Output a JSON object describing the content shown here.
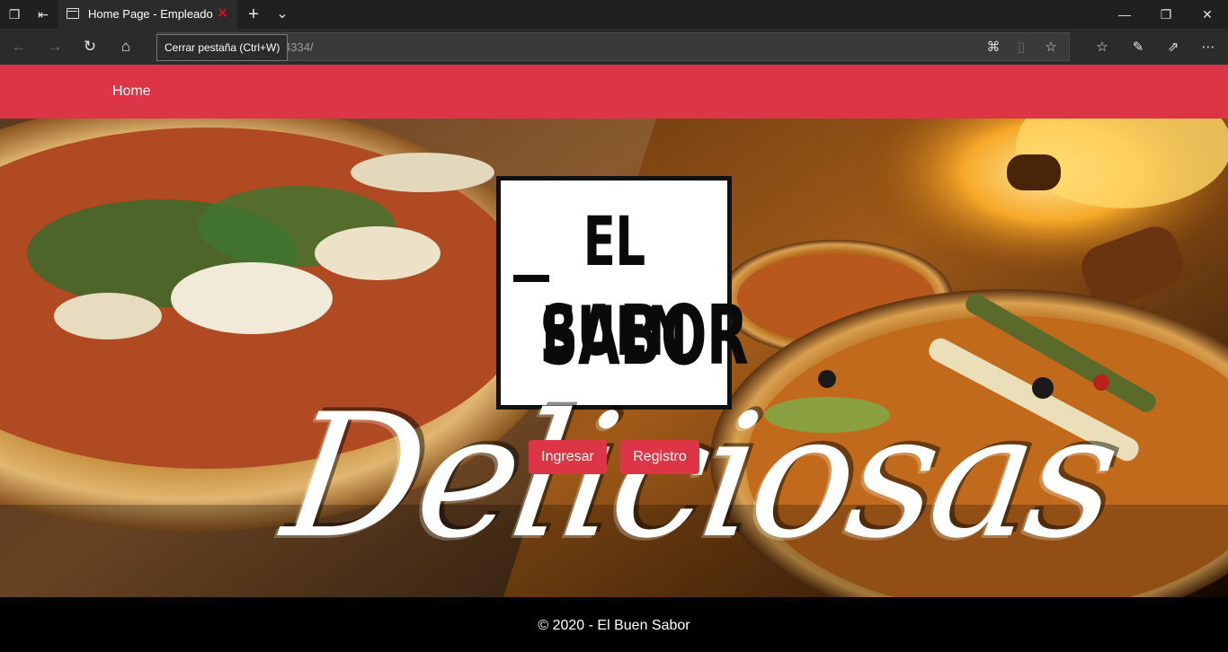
{
  "browser": {
    "tab_title": "Home Page - Empleado",
    "tab_close_icon": "✕",
    "new_tab_icon": "+",
    "tab_list_icon": "⌄",
    "tooltip": "Cerrar pestaña (Ctrl+W)",
    "url_visible": "4334/",
    "icons": {
      "tab_actions": "tab-actions-icon",
      "set_aside": "set-aside-tabs-icon",
      "back": "back-arrow-icon",
      "forward": "forward-arrow-icon",
      "refresh": "refresh-icon",
      "home": "home-icon",
      "translate": "translate-icon",
      "reading_view": "reading-view-icon",
      "favorite": "star-icon",
      "favorites_hub": "favorites-icon",
      "notes": "pen-icon",
      "share": "share-icon",
      "more": "more-icon"
    }
  },
  "navbar": {
    "home_label": "Home",
    "color": "#dc3545"
  },
  "hero": {
    "logo_line1": "EL BUEN",
    "logo_line2": "SABOR",
    "script_word": "Deliciosas",
    "buttons": {
      "ingresar": "Ingresar",
      "registro": "Registro"
    }
  },
  "footer": {
    "text": "© 2020 - El Buen Sabor"
  }
}
